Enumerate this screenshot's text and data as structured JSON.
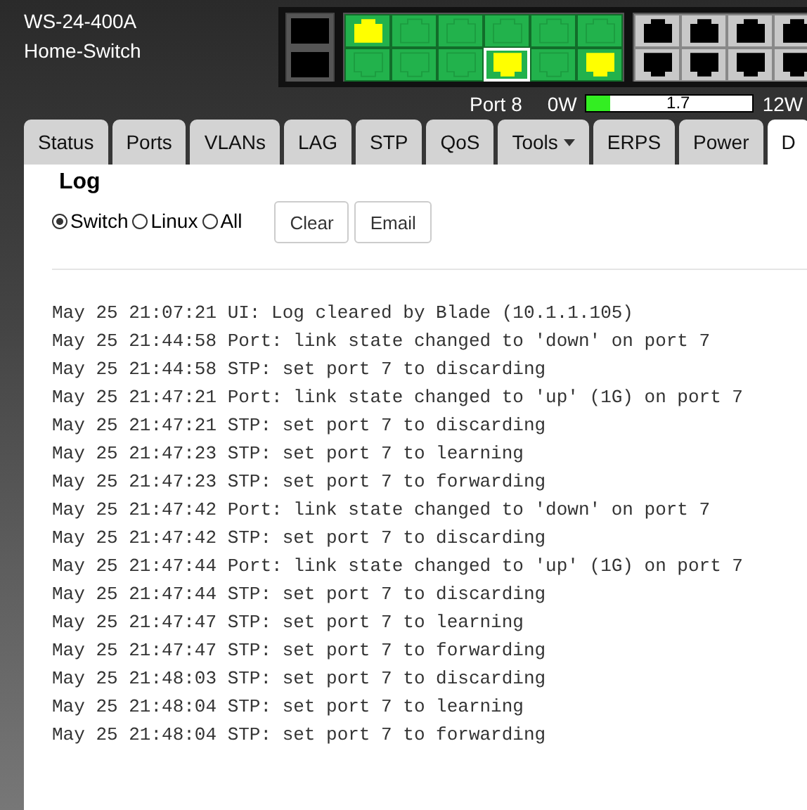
{
  "device": {
    "model": "WS-24-400A",
    "name": "Home-Switch"
  },
  "port_groups": [
    {
      "kind": "sfp",
      "rows": [
        [
          {
            "color": "#000000",
            "selected": false
          }
        ],
        [
          {
            "color": "#000000",
            "selected": false
          }
        ]
      ]
    },
    {
      "kind": "rj45",
      "rows": [
        [
          {
            "color": "#ffff00",
            "selected": false
          },
          {
            "color": "#22b24c",
            "selected": false
          },
          {
            "color": "#22b24c",
            "selected": false
          },
          {
            "color": "#22b24c",
            "selected": false
          },
          {
            "color": "#22b24c",
            "selected": false
          },
          {
            "color": "#22b24c",
            "selected": false
          }
        ],
        [
          {
            "color": "#22b24c",
            "selected": false
          },
          {
            "color": "#22b24c",
            "selected": false
          },
          {
            "color": "#22b24c",
            "selected": false
          },
          {
            "color": "#ffff00",
            "selected": true
          },
          {
            "color": "#22b24c",
            "selected": false
          },
          {
            "color": "#ffff00",
            "selected": false
          }
        ]
      ]
    },
    {
      "kind": "rj45",
      "rows": [
        [
          {
            "color": "#000000",
            "selected": false
          },
          {
            "color": "#000000",
            "selected": false
          },
          {
            "color": "#000000",
            "selected": false
          },
          {
            "color": "#000000",
            "selected": false
          }
        ],
        [
          {
            "color": "#000000",
            "selected": false
          },
          {
            "color": "#000000",
            "selected": false
          },
          {
            "color": "#000000",
            "selected": false
          },
          {
            "color": "#000000",
            "selected": false
          }
        ]
      ]
    }
  ],
  "power": {
    "port": "Port 8",
    "min": "0W",
    "level": 0.14,
    "reading": "1.7",
    "max": "12W"
  },
  "tabs": [
    {
      "label": "Status",
      "selected": false
    },
    {
      "label": "Ports",
      "selected": false
    },
    {
      "label": "VLANs",
      "selected": false
    },
    {
      "label": "LAG",
      "selected": false
    },
    {
      "label": "STP",
      "selected": false
    },
    {
      "label": "QoS",
      "selected": false
    },
    {
      "label": "Tools",
      "selected": false,
      "dropdown": true
    },
    {
      "label": "ERPS",
      "selected": false
    },
    {
      "label": "Power",
      "selected": false
    },
    {
      "label": "D",
      "selected": true
    }
  ],
  "heading": "Log",
  "sources": [
    {
      "label": "Switch",
      "selected": true
    },
    {
      "label": "Linux",
      "selected": false
    },
    {
      "label": "All",
      "selected": false
    }
  ],
  "buttons": [
    "Clear",
    "Email"
  ],
  "log": [
    "May 25 21:07:21 UI: Log cleared by Blade (10.1.1.105)",
    "May 25 21:44:58 Port: link state changed to 'down' on port 7",
    "May 25 21:44:58 STP: set port 7 to discarding",
    "May 25 21:47:21 Port: link state changed to 'up' (1G) on port 7",
    "May 25 21:47:21 STP: set port 7 to discarding",
    "May 25 21:47:23 STP: set port 7 to learning",
    "May 25 21:47:23 STP: set port 7 to forwarding",
    "May 25 21:47:42 Port: link state changed to 'down' on port 7",
    "May 25 21:47:42 STP: set port 7 to discarding",
    "May 25 21:47:44 Port: link state changed to 'up' (1G) on port 7",
    "May 25 21:47:44 STP: set port 7 to discarding",
    "May 25 21:47:47 STP: set port 7 to learning",
    "May 25 21:47:47 STP: set port 7 to forwarding",
    "May 25 21:48:03 STP: set port 7 to discarding",
    "May 25 21:48:04 STP: set port 7 to learning",
    "May 25 21:48:04 STP: set port 7 to forwarding"
  ]
}
